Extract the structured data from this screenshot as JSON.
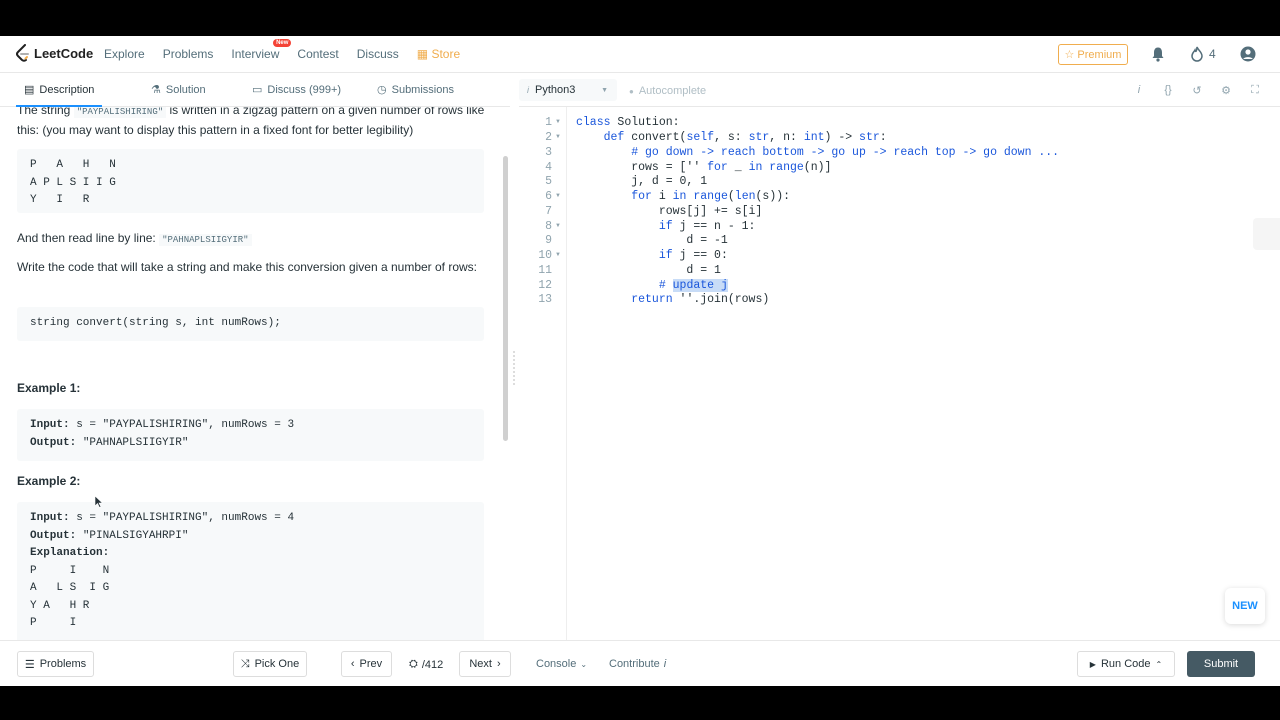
{
  "nav": {
    "logo": "LeetCode",
    "links": [
      "Explore",
      "Problems",
      "Interview",
      "Contest",
      "Discuss",
      "Store"
    ],
    "interview_badge": "New",
    "premium": "Premium",
    "streak": "4"
  },
  "left_tabs": {
    "description": "Description",
    "solution": "Solution",
    "discuss": "Discuss (999+)",
    "submissions": "Submissions"
  },
  "problem": {
    "intro_pre": "The string",
    "intro_code": "\"PAYPALISHIRING\"",
    "intro_post": "is written in a zigzag pattern on a given number of rows like this: (you may want to display this pattern in a fixed font for better legibility)",
    "zigzag": "P   A   H   N\nA P L S I I G\nY   I   R",
    "read_pre": "And then read line by line:",
    "read_code": "\"PAHNAPLSIIGYIR\"",
    "write_text": "Write the code that will take a string and make this conversion given a number of rows:",
    "signature": "string convert(string s, int numRows);",
    "example1_title": "Example 1:",
    "ex1_input_label": "Input:",
    "ex1_input": " s = \"PAYPALISHIRING\", numRows = 3",
    "ex1_output_label": "Output:",
    "ex1_output": " \"PAHNAPLSIIGYIR\"",
    "example2_title": "Example 2:",
    "ex2_input_label": "Input:",
    "ex2_input": " s = \"PAYPALISHIRING\", numRows = 4",
    "ex2_output_label": "Output:",
    "ex2_output": " \"PINALSIGYAHRPI\"",
    "ex2_expl_label": "Explanation:",
    "ex2_expl": "P     I    N\nA   L S  I G\nY A   H R\nP     I"
  },
  "editor": {
    "language": "Python3",
    "autocomplete": "Autocomplete",
    "line_numbers": [
      "1",
      "2",
      "3",
      "4",
      "5",
      "6",
      "7",
      "8",
      "9",
      "10",
      "11",
      "12",
      "13"
    ],
    "lines": [
      "class Solution:",
      "    def convert(self, s: str, n: int) -> str:",
      "        # go down -> reach bottom -> go up -> reach top -> go down ...",
      "        rows = ['' for _ in range(n)]",
      "        j, d = 0, 1",
      "        for i in range(len(s)):",
      "            rows[j] += s[i]",
      "            if j == n - 1:",
      "                d = -1",
      "            if j == 0:",
      "                d = 1",
      "            # update j",
      "        return ''.join(rows)"
    ],
    "new_badge": "NEW"
  },
  "bottom": {
    "problems": "Problems",
    "pick_one": "Pick One",
    "prev": "Prev",
    "page": "/412",
    "next": "Next",
    "console": "Console",
    "contribute": "Contribute",
    "run_code": "Run Code",
    "submit": "Submit"
  },
  "colors": {
    "accent": "#1a90ff",
    "premium": "#f0ad4e",
    "submit": "#455a64",
    "keyword": "#1a56db"
  }
}
